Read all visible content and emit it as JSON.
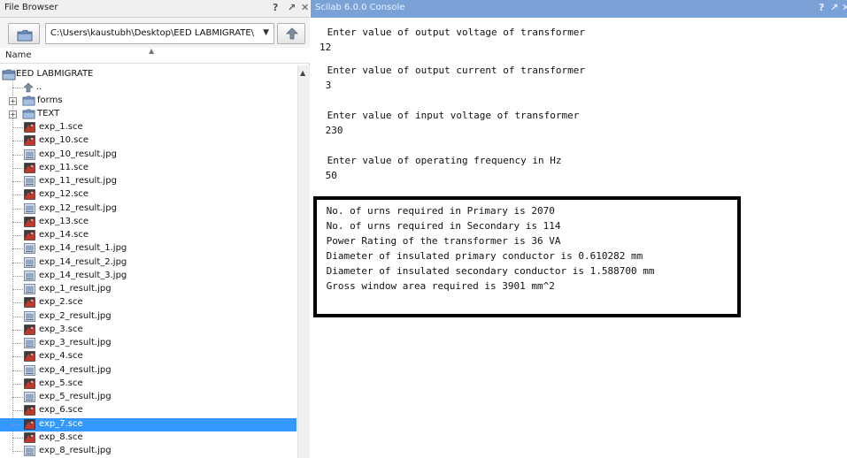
{
  "file_browser": {
    "title": "File Browser",
    "controls": [
      "?",
      "↗",
      "✕"
    ],
    "path": "C:\\Users\\kaustubh\\Desktop\\EED LABMIGRATE\\",
    "column_header": "Name",
    "root": "EED LABMIGRATE",
    "parent": "..",
    "folders": [
      "forms",
      "TEXT"
    ],
    "files": [
      {
        "name": "exp_1.sce",
        "type": "sce"
      },
      {
        "name": "exp_10.sce",
        "type": "sce"
      },
      {
        "name": "exp_10_result.jpg",
        "type": "jpg"
      },
      {
        "name": "exp_11.sce",
        "type": "sce"
      },
      {
        "name": "exp_11_result.jpg",
        "type": "jpg"
      },
      {
        "name": "exp_12.sce",
        "type": "sce"
      },
      {
        "name": "exp_12_result.jpg",
        "type": "jpg"
      },
      {
        "name": "exp_13.sce",
        "type": "sce"
      },
      {
        "name": "exp_14.sce",
        "type": "sce"
      },
      {
        "name": "exp_14_result_1.jpg",
        "type": "jpg"
      },
      {
        "name": "exp_14_result_2.jpg",
        "type": "jpg"
      },
      {
        "name": "exp_14_result_3.jpg",
        "type": "jpg"
      },
      {
        "name": "exp_1_result.jpg",
        "type": "jpg"
      },
      {
        "name": "exp_2.sce",
        "type": "sce"
      },
      {
        "name": "exp_2_result.jpg",
        "type": "jpg"
      },
      {
        "name": "exp_3.sce",
        "type": "sce"
      },
      {
        "name": "exp_3_result.jpg",
        "type": "jpg"
      },
      {
        "name": "exp_4.sce",
        "type": "sce"
      },
      {
        "name": "exp_4_result.jpg",
        "type": "jpg"
      },
      {
        "name": "exp_5.sce",
        "type": "sce"
      },
      {
        "name": "exp_5_result.jpg",
        "type": "jpg"
      },
      {
        "name": "exp_6.sce",
        "type": "sce"
      },
      {
        "name": "exp_7.sce",
        "type": "sce",
        "selected": true
      },
      {
        "name": "exp_8.sce",
        "type": "sce"
      },
      {
        "name": "exp_8_result.jpg",
        "type": "jpg"
      }
    ],
    "selection_color": "#3399ff"
  },
  "console": {
    "title": "Scilab 6.0.0 Console",
    "controls": [
      "?",
      "↗",
      "✕"
    ],
    "title_bar_color": "#7aa2d6",
    "prompts": [
      {
        "question": " Enter value of output voltage of transformer",
        "answer": "12"
      },
      {
        "question": " Enter value of output current of transformer",
        "answer": " 3"
      },
      {
        "question": " Enter value of input voltage of transformer",
        "answer": " 230"
      },
      {
        "question": " Enter value of operating frequency in Hz",
        "answer": " 50"
      }
    ],
    "results": [
      " No. of urns required in Primary is 2070",
      " No. of urns required in Secondary is 114",
      " Power Rating of the transformer is 36 VA",
      " Diameter of insulated primary conductor is 0.610282 mm",
      " Diameter of insulated secondary conductor is 1.588700 mm",
      " Gross window area required is 3901 mm^2"
    ]
  }
}
